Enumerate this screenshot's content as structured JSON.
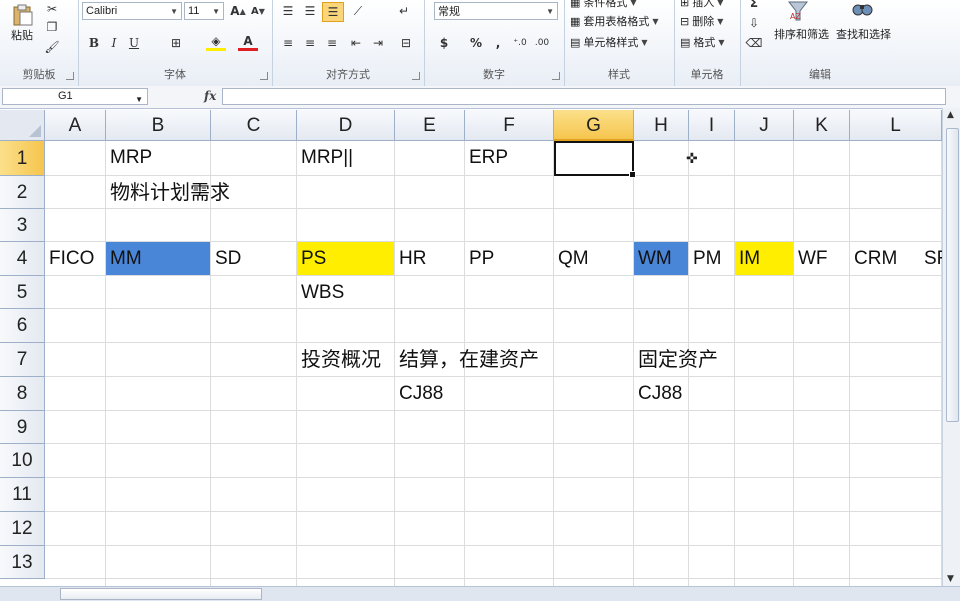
{
  "ribbon": {
    "clipboard": {
      "label": "剪贴板",
      "paste": "粘贴"
    },
    "font": {
      "label": "字体",
      "name": "Calibri",
      "size": "11"
    },
    "alignment": {
      "label": "对齐方式"
    },
    "number": {
      "label": "数字",
      "format": "常规"
    },
    "styles": {
      "label": "样式",
      "conditional": "条件格式",
      "table": "套用表格格式",
      "cell": "单元格样式"
    },
    "cells": {
      "label": "单元格",
      "insert": "插入",
      "delete": "删除",
      "format": "格式"
    },
    "editing": {
      "label": "编辑",
      "sort": "排序和筛选",
      "find": "查找和选择"
    }
  },
  "formula_bar": {
    "name_box": "G1",
    "fx": "fx",
    "value": ""
  },
  "columns": [
    "A",
    "B",
    "C",
    "D",
    "E",
    "F",
    "G",
    "H",
    "I",
    "J",
    "K",
    "L"
  ],
  "rows": [
    "1",
    "2",
    "3",
    "4",
    "5",
    "6",
    "7",
    "8",
    "9",
    "10",
    "11",
    "12",
    "13"
  ],
  "selected_cell": "G1",
  "cells": {
    "B1": "MRP",
    "D1": "MRP||",
    "F1": "ERP",
    "B2": "物料计划需求",
    "A4": "FICO",
    "B4": "MM",
    "C4": "SD",
    "D4": "PS",
    "E4": "HR",
    "F4": "PP",
    "G4": "QM",
    "H4": "WM",
    "I4": "PM",
    "J4": "IM",
    "K4": "WF",
    "L4": "CRM",
    "M4": "SR",
    "D5": "WBS",
    "D7": "投资概况",
    "E7": "结算，在建资产",
    "H7": "固定资产",
    "E8": "CJ88",
    "H8": "CJ88"
  },
  "fills": {
    "B4": "#4a86d8",
    "D4": "#ffee00",
    "H4": "#4a86d8",
    "J4": "#ffee00"
  }
}
